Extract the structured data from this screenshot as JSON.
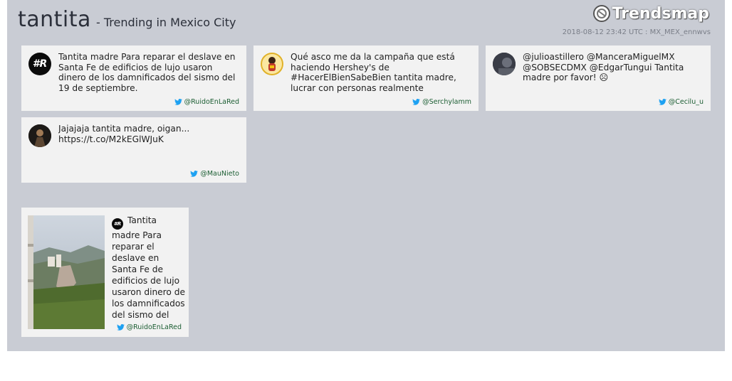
{
  "header": {
    "term": "tantita",
    "subtitle": "- Trending in Mexico City",
    "brand": "Trendsmap",
    "timestamp": "2018-08-12 23:42 UTC : MX_MEX_ennwvs"
  },
  "tweets": [
    {
      "text": "Tantita madre Para reparar el deslave en Santa Fe de edificios de lujo usaron dinero de los damnificados del sismo del 19 de septiembre.",
      "handle": "@RuidoEnLaRed",
      "avatar_icon": "ruido-en-la-red-logo-icon"
    },
    {
      "text": "Qué asco me da la campaña que está haciendo Hershey's de #HacerElBienSabeBien tantita madre, lucrar con personas realmente",
      "handle": "@Serchylamm",
      "avatar_icon": "user-avatar-icon"
    },
    {
      "text": "@julioastillero @ManceraMiguelMX @SOBSECDMX @EdgarTungui Tantita madre por favor! ☹",
      "handle": "@Cecilu_u",
      "avatar_icon": "user-avatar-icon"
    },
    {
      "text": "Jajajaja tantita madre, oigan... https://t.co/M2kEGlWJuK",
      "handle": "@MauNieto",
      "avatar_icon": "user-avatar-icon"
    }
  ],
  "media_tweet": {
    "text": "Tantita madre Para reparar el deslave en Santa Fe de edificios de lujo usaron dinero de los damnificados del sismo del",
    "handle": "@RuidoEnLaRed",
    "avatar_text": "#R"
  },
  "colors": {
    "panel": "#c9ccd4",
    "card": "#f2f2f2",
    "twitter": "#1da1f2",
    "handle": "#1c5e33"
  }
}
